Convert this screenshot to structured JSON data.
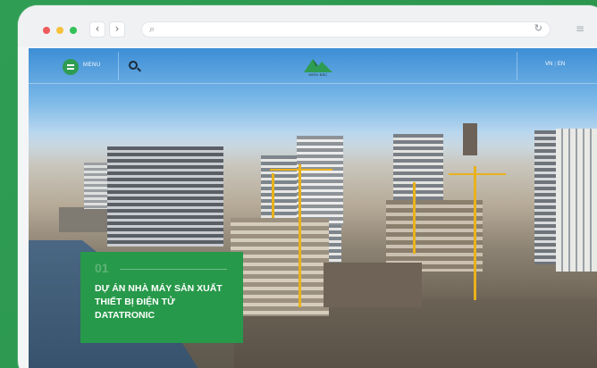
{
  "browser": {
    "back_icon": "‹",
    "forward_icon": "›",
    "search_icon": "⌕",
    "reload_icon": "↻",
    "menu_icon": "≡"
  },
  "site": {
    "menu_label": "MENU",
    "logo_text": "MIỀN BẮC",
    "lang_vn": "VN",
    "lang_sep": "|",
    "lang_en": "EN"
  },
  "card": {
    "number": "01",
    "title": "DỰ ÁN NHÀ MÁY SẢN XUẤT THIẾT BỊ ĐIỆN TỬ DATATRONIC"
  },
  "colors": {
    "brand_green": "#27994a",
    "outer_green": "#2e9c52"
  }
}
